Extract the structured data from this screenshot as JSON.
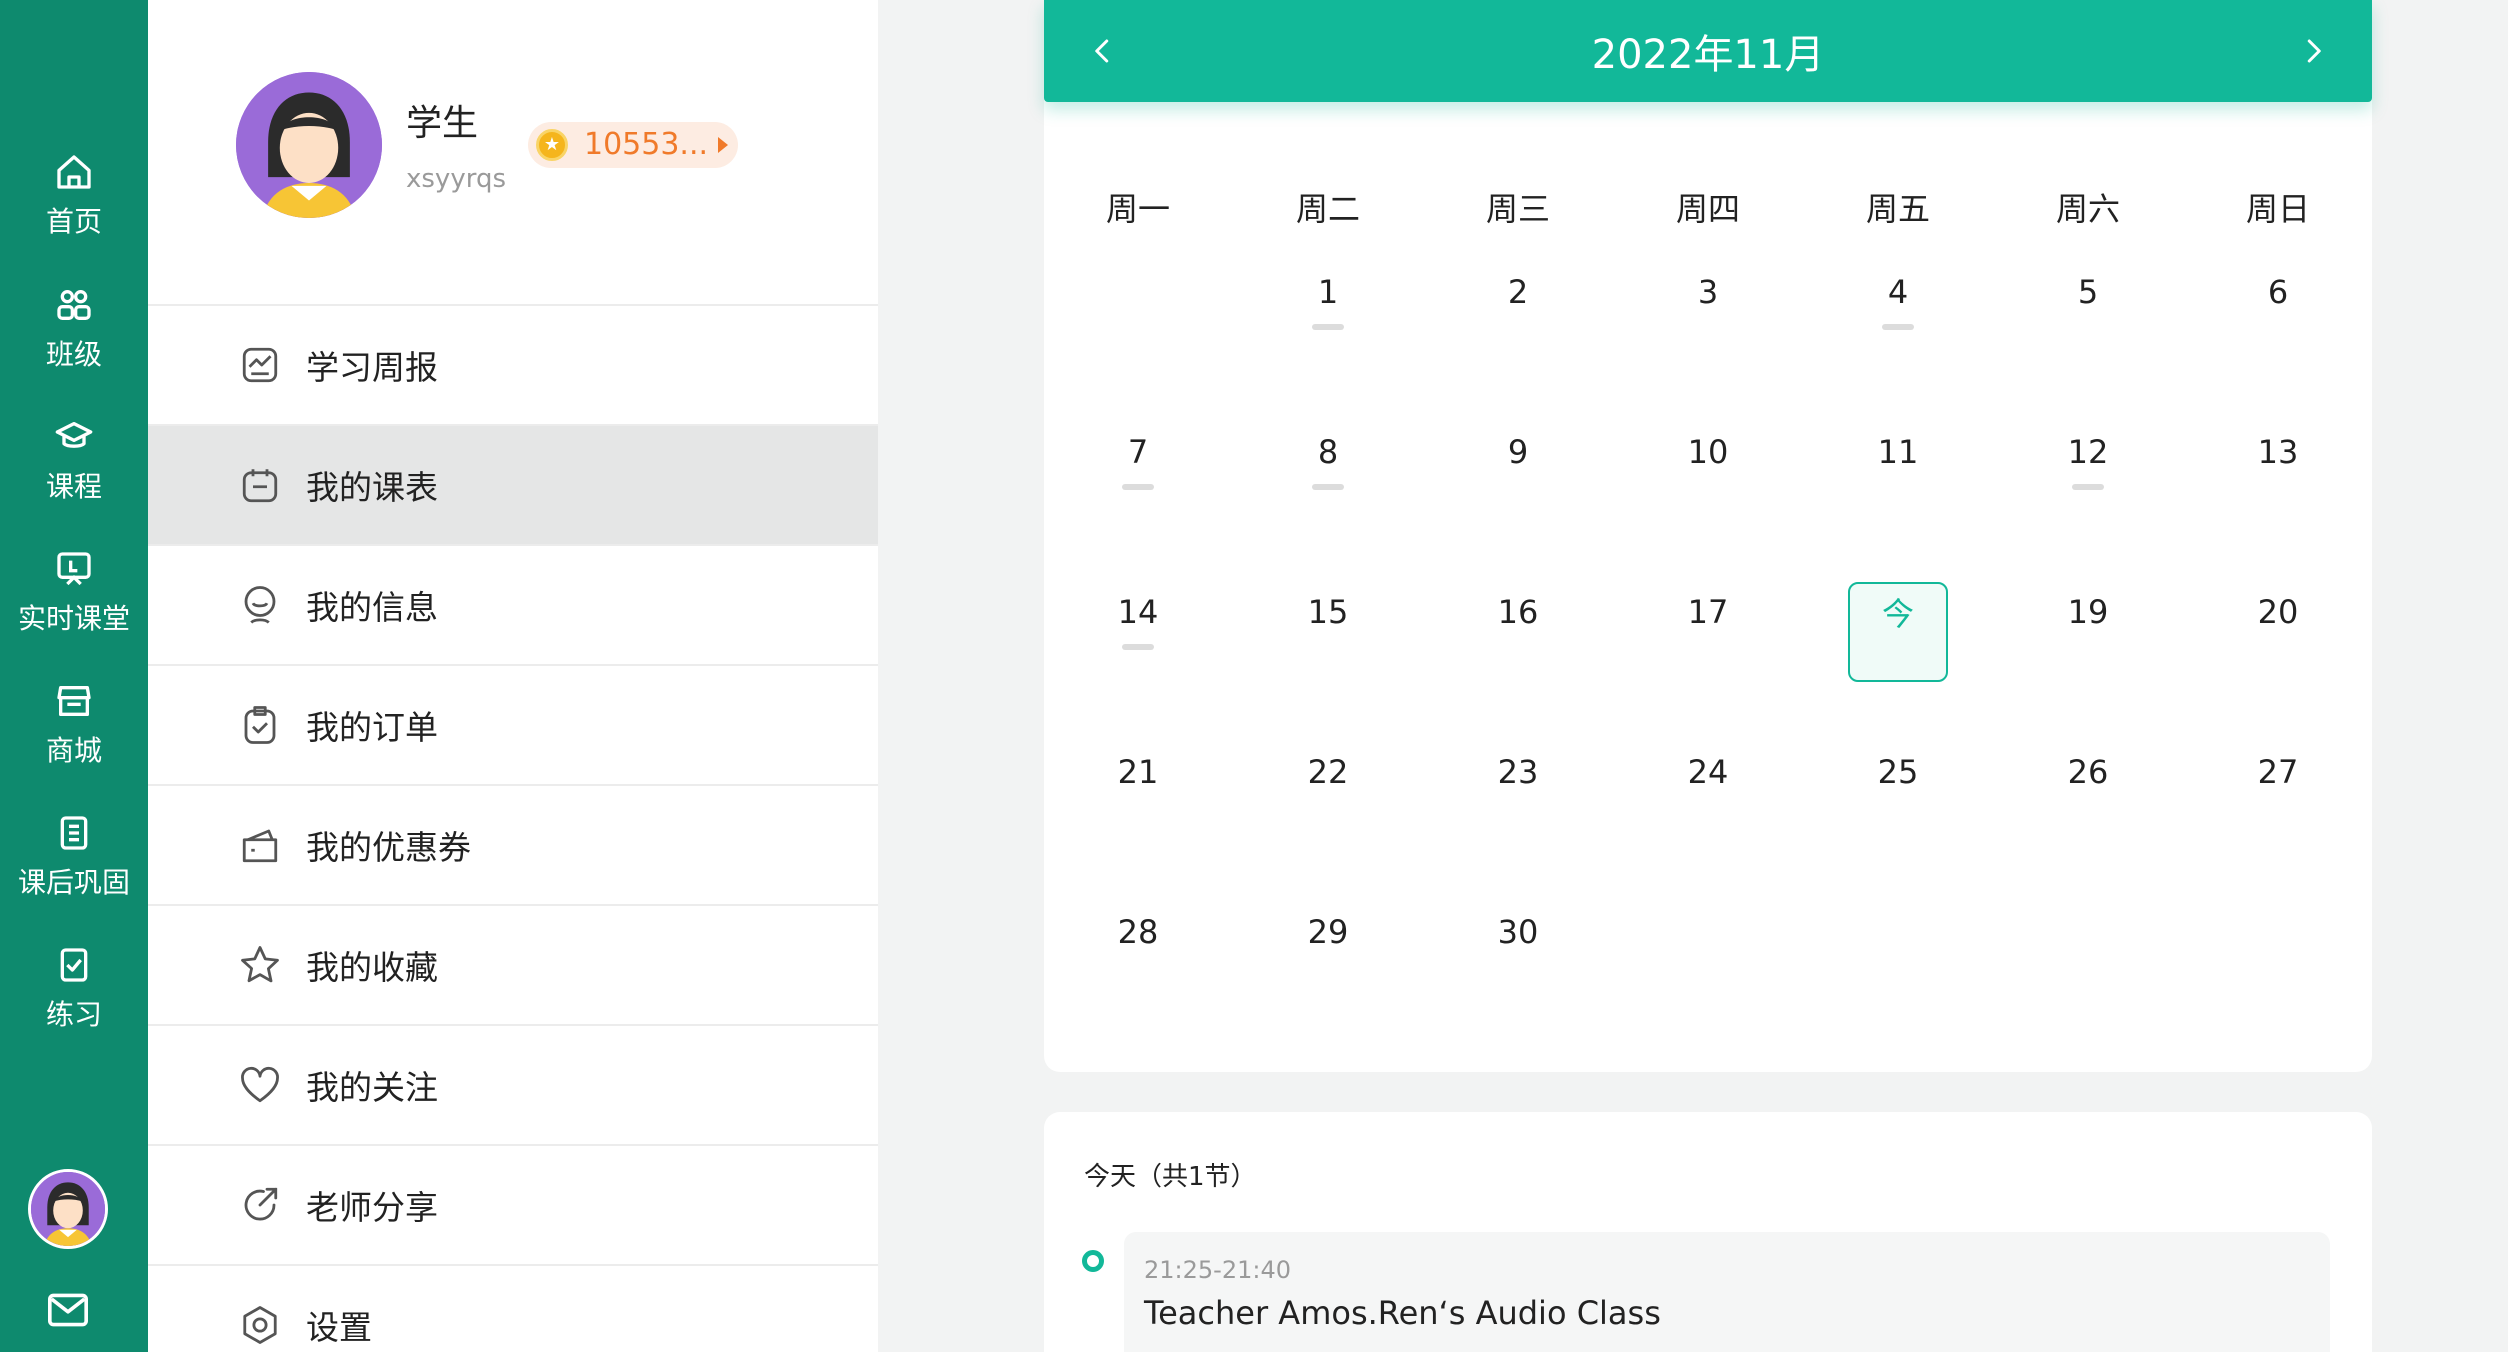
{
  "rail": {
    "items": [
      {
        "label": "首页",
        "icon": "home-icon"
      },
      {
        "label": "班级",
        "icon": "class-icon"
      },
      {
        "label": "课程",
        "icon": "course-icon"
      },
      {
        "label": "实时课堂",
        "icon": "live-classroom-icon"
      },
      {
        "label": "商城",
        "icon": "store-icon"
      },
      {
        "label": "课后巩固",
        "icon": "review-icon"
      },
      {
        "label": "练习",
        "icon": "practice-icon"
      }
    ]
  },
  "profile": {
    "name": "学生",
    "user_id": "xsyyrqs",
    "coins": "10553..."
  },
  "menu": {
    "items": [
      {
        "label": "学习周报",
        "icon": "chart-icon"
      },
      {
        "label": "我的课表",
        "icon": "calendar-icon",
        "active": true
      },
      {
        "label": "我的信息",
        "icon": "user-icon"
      },
      {
        "label": "我的订单",
        "icon": "order-icon"
      },
      {
        "label": "我的优惠券",
        "icon": "coupon-icon"
      },
      {
        "label": "我的收藏",
        "icon": "star-icon"
      },
      {
        "label": "我的关注",
        "icon": "heart-icon"
      },
      {
        "label": "老师分享",
        "icon": "share-icon"
      },
      {
        "label": "设置",
        "icon": "settings-icon"
      }
    ]
  },
  "calendar": {
    "title": "2022年11月",
    "weekdays": [
      "周一",
      "周二",
      "周三",
      "周四",
      "周五",
      "周六",
      "周日"
    ],
    "first_weekday": 1,
    "days_in_month": 30,
    "today": 18,
    "today_label": "今",
    "marked_days": [
      1,
      4,
      7,
      8,
      12,
      14
    ]
  },
  "today_list": {
    "title": "今天（共1节）",
    "lessons": [
      {
        "time": "21:25-21:40",
        "name": "Teacher Amos.Ren‘s Audio Class"
      }
    ]
  },
  "colors": {
    "rail": "#0e8a6e",
    "accent": "#12b899",
    "coin": "#f07a2a"
  }
}
